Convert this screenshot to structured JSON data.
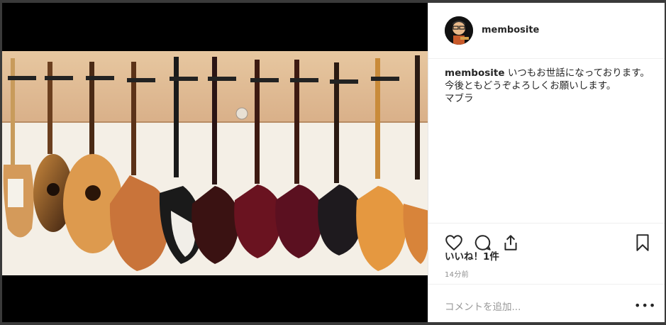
{
  "post": {
    "username": "membosite",
    "caption_line1": "いつもお世話になっております。",
    "caption_line2": "今後ともどうぞよろしくお願いします。",
    "caption_line3": "マブラ",
    "likes": "いいね！1件",
    "timestamp": "14分前",
    "comment_placeholder": "コメントを追加...",
    "more_glyph": "•••"
  },
  "icons": {
    "like": "heart-icon",
    "comment": "comment-bubble-icon",
    "share": "share-upload-icon",
    "save": "bookmark-icon",
    "more": "more-options-icon"
  },
  "colors": {
    "text": "#262626",
    "muted": "#8e8e8e",
    "divider": "#efefef",
    "backdrop": "#000000"
  }
}
